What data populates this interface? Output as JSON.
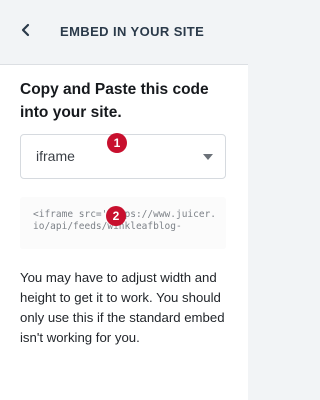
{
  "header": {
    "title": "EMBED IN YOUR SITE",
    "back_icon": "chevron-left-icon"
  },
  "main": {
    "heading": "Copy and Paste this code into your site.",
    "embed_type": {
      "value": "iframe",
      "icon": "caret-down-icon"
    },
    "code_snippet": "<iframe src='https://www.juicer.io/api/feeds/winkleafblog-",
    "note": "You may have to adjust width and height to get it to work. You should only use this if the standard embed isn't working for you."
  },
  "annotations": {
    "marker_1": "1",
    "marker_2": "2",
    "marker_color": "#c8102e"
  },
  "colors": {
    "header_bg": "#f2f4f6",
    "panel_bg": "#ffffff",
    "title_text": "#2b3a4a"
  }
}
